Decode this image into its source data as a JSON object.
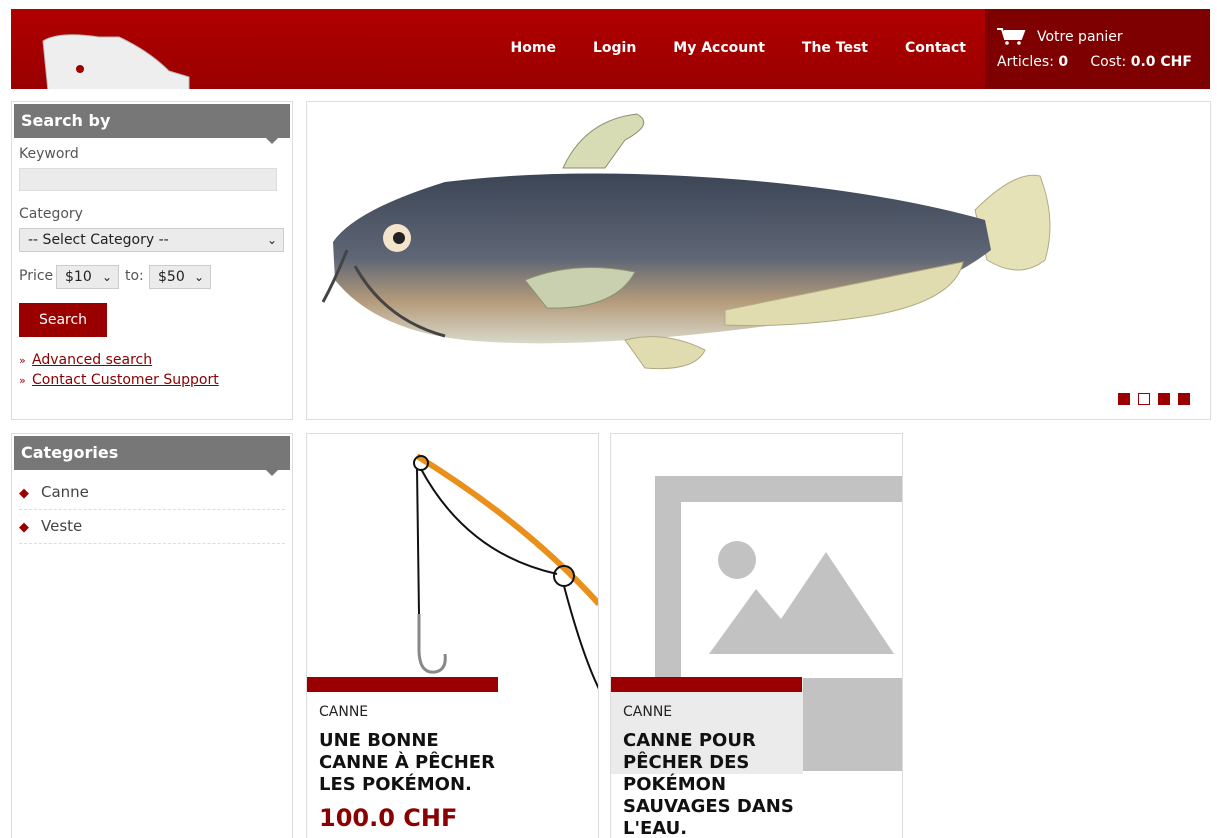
{
  "nav": {
    "items": [
      "Home",
      "Login",
      "My Account",
      "The Test",
      "Contact"
    ]
  },
  "cart": {
    "title": "Votre panier",
    "articles_label": "Articles:",
    "articles_value": "0",
    "cost_label": "Cost:",
    "cost_value": "0.0 CHF"
  },
  "search": {
    "title": "Search by",
    "keyword_label": "Keyword",
    "keyword_value": "",
    "category_label": "Category",
    "category_selected": "-- Select Category --",
    "price_label": "Price",
    "price_from": "$10",
    "to_label": "to:",
    "price_to": "$50",
    "button": "Search",
    "links": [
      "Advanced search",
      "Contact Customer Support"
    ]
  },
  "categories": {
    "title": "Categories",
    "items": [
      "Canne",
      "Veste"
    ]
  },
  "slider": {
    "dots": 4,
    "active_empty_index": 1
  },
  "products": [
    {
      "category": "CANNE",
      "title": "UNE BONNE CANNE À PÊCHER LES POKÉMON.",
      "price": "100.0 CHF"
    },
    {
      "category": "CANNE",
      "title": "CANNE POUR PÊCHER DES POKÉMON SAUVAGES DANS L'EAU.",
      "price": ""
    }
  ],
  "colors": {
    "brand": "#9a0000",
    "panel_head": "#777777"
  }
}
